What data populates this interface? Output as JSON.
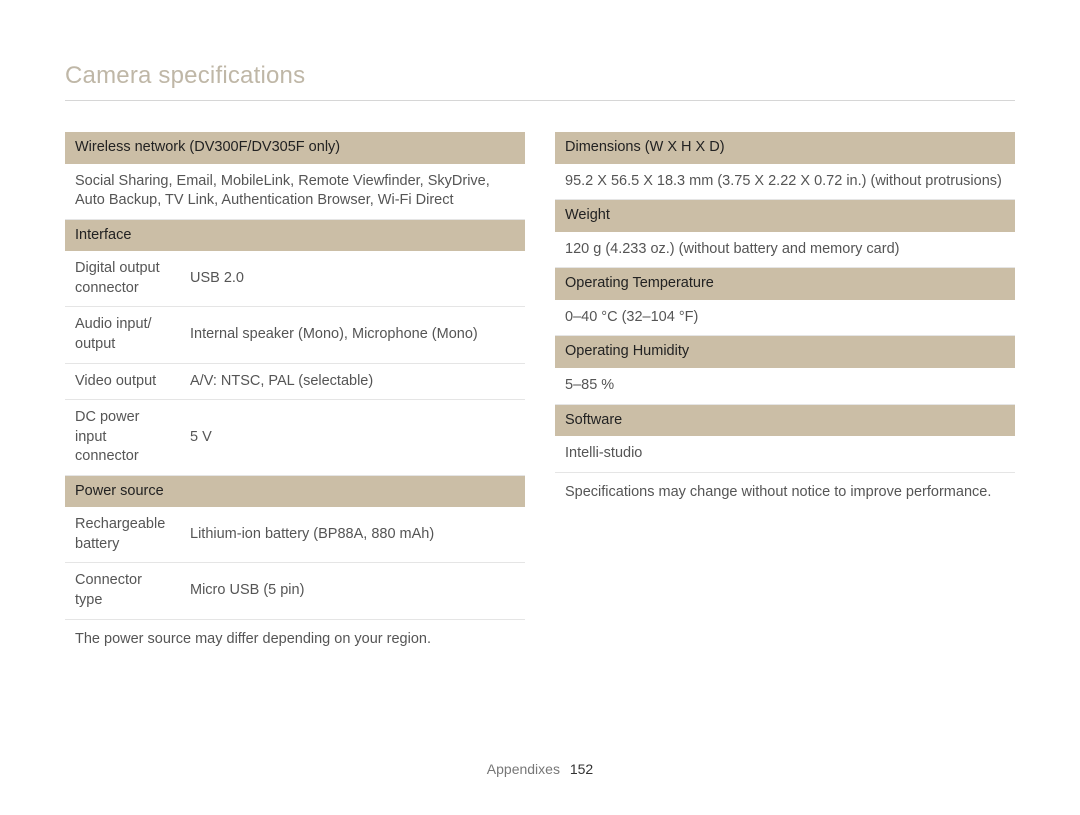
{
  "title": "Camera specifications",
  "left": {
    "wireless_header": "Wireless network (DV300F/DV305F only)",
    "wireless_body": "Social Sharing, Email, MobileLink, Remote Viewfinder, SkyDrive, Auto Backup, TV Link, Authentication Browser, Wi-Fi Direct",
    "interface_header": "Interface",
    "iface": {
      "digital_out_label": "Digital output connector",
      "digital_out_value": "USB 2.0",
      "audio_label": "Audio input/ output",
      "audio_value": "Internal speaker (Mono), Microphone (Mono)",
      "video_out_label": "Video output",
      "video_out_value": "A/V: NTSC, PAL (selectable)",
      "dc_label": "DC power input connector",
      "dc_value": "5 V"
    },
    "power_header": "Power source",
    "power": {
      "battery_label": "Rechargeable battery",
      "battery_value": "Lithium-ion battery (BP88A, 880 mAh)",
      "connector_label": "Connector type",
      "connector_value": "Micro USB (5 pin)"
    },
    "power_note": "The power source may differ depending on your region."
  },
  "right": {
    "dimensions_header": "Dimensions (W X H X D)",
    "dimensions_value": "95.2 X 56.5 X 18.3 mm (3.75 X 2.22 X 0.72 in.) (without protrusions)",
    "weight_header": "Weight",
    "weight_value": "120 g (4.233 oz.) (without battery and memory card)",
    "optemp_header": "Operating Temperature",
    "optemp_value": "0–40 °C (32–104 °F)",
    "ophum_header": "Operating Humidity",
    "ophum_value": "5–85 %",
    "software_header": "Software",
    "software_value": "Intelli-studio",
    "disclaimer": "Specifications may change without notice to improve performance."
  },
  "footer": {
    "section": "Appendixes",
    "page": "152"
  }
}
